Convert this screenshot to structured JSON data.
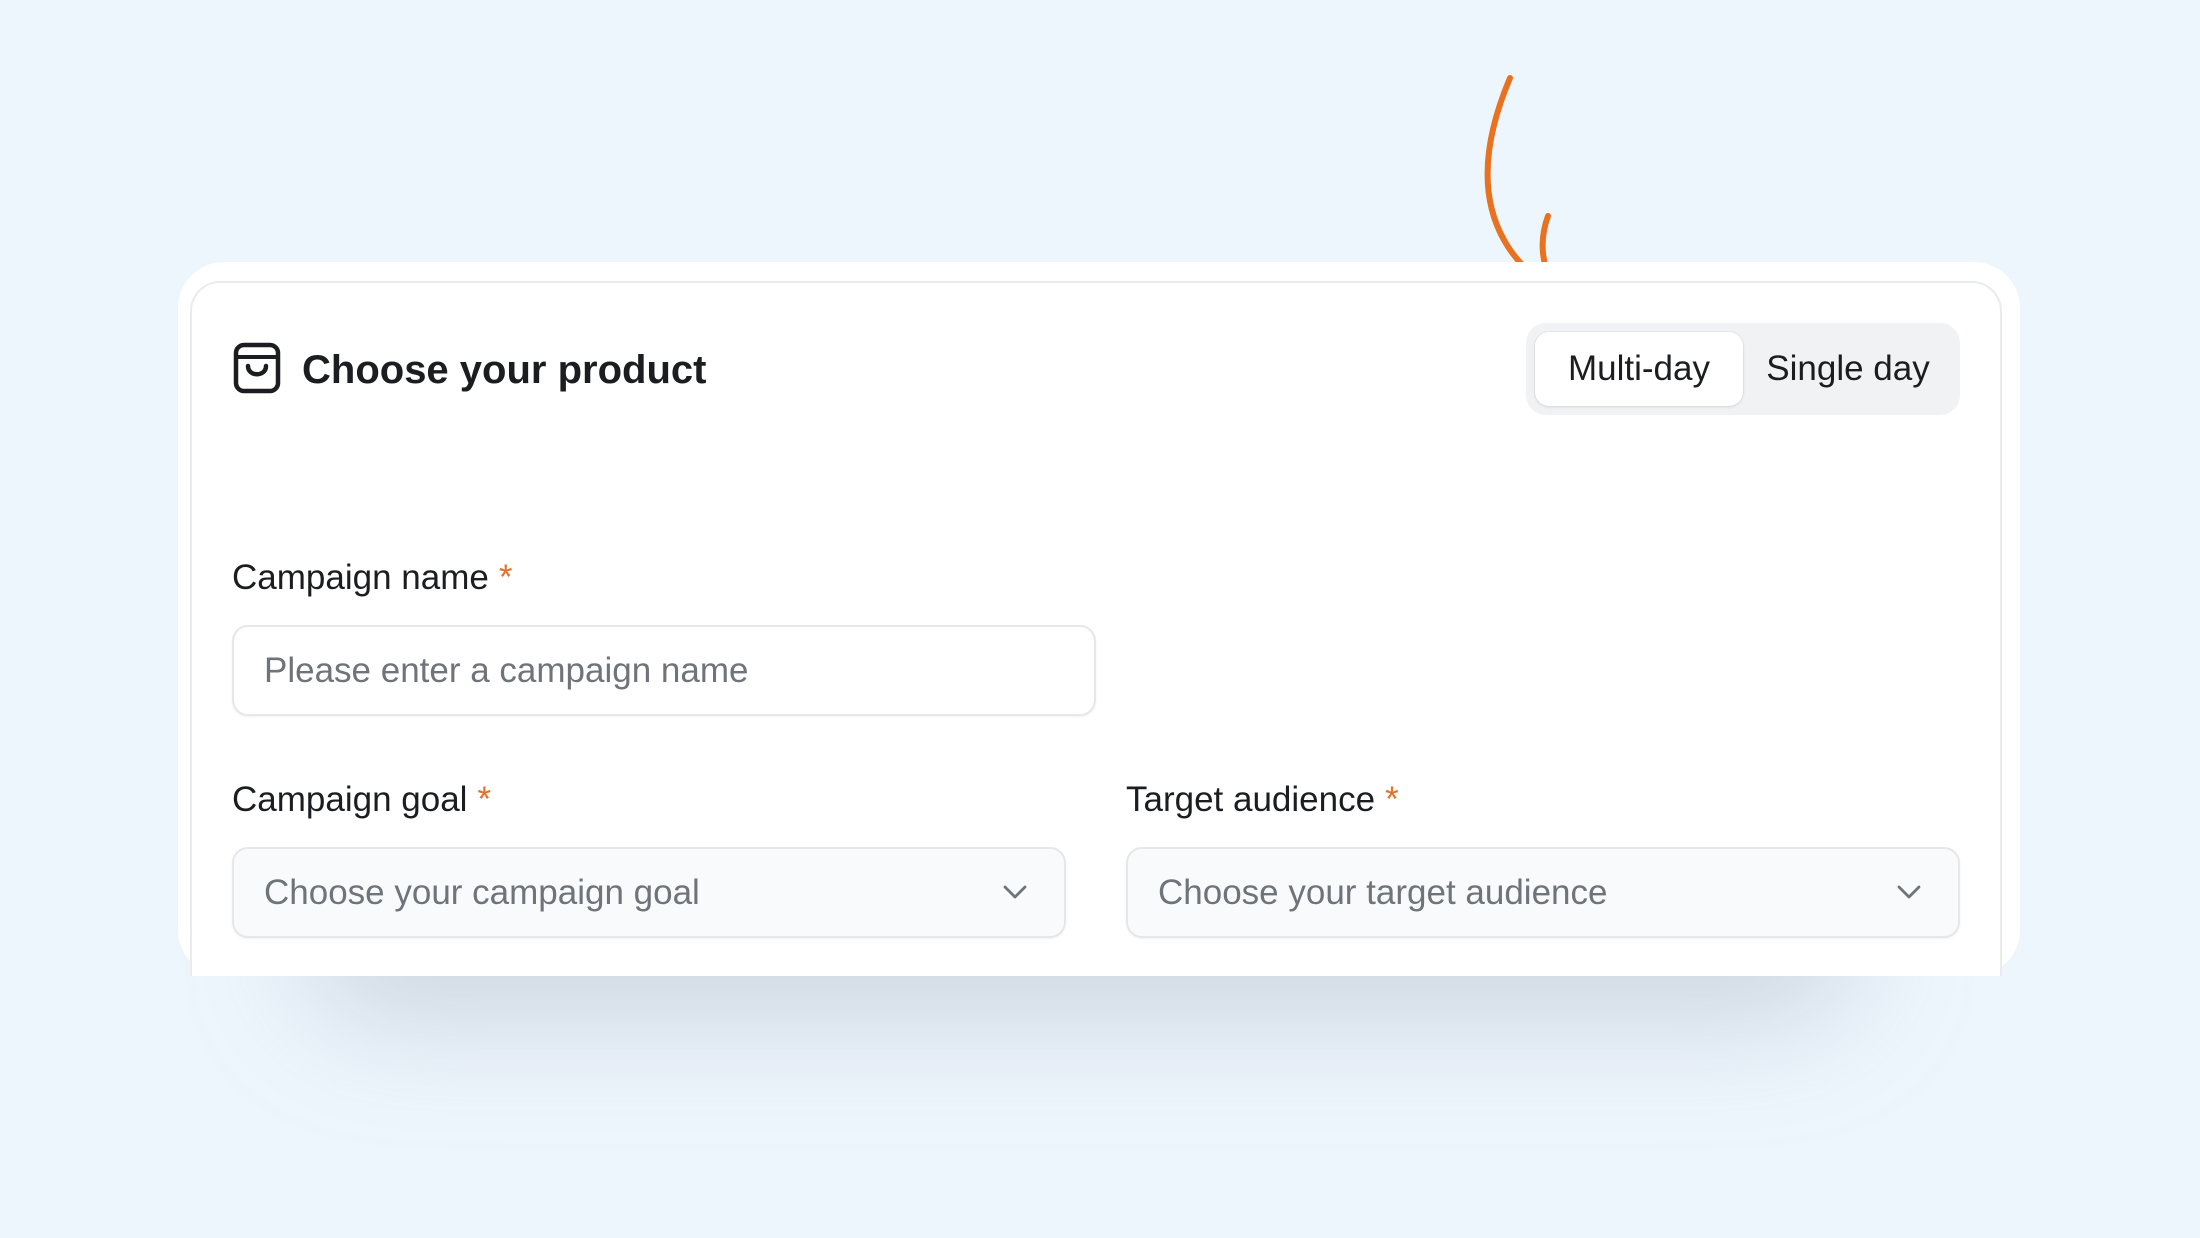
{
  "header": {
    "title": "Choose your product",
    "icon": "shopping-bag-icon"
  },
  "duration_toggle": {
    "options": [
      {
        "label": "Multi-day",
        "selected": true
      },
      {
        "label": "Single day",
        "selected": false
      }
    ]
  },
  "form": {
    "campaign_name": {
      "label": "Campaign name",
      "required_marker": "*",
      "placeholder": "Please enter a campaign name",
      "value": ""
    },
    "campaign_goal": {
      "label": "Campaign goal",
      "required_marker": "*",
      "placeholder": "Choose your campaign goal",
      "icon": "chevron-down-icon"
    },
    "target_audience": {
      "label": "Target audience",
      "required_marker": "*",
      "placeholder": "Choose your target audience",
      "icon": "chevron-down-icon"
    }
  },
  "annotation": {
    "icon": "hand-drawn-arrow-icon",
    "color": "#e8721f"
  },
  "colors": {
    "background": "#eef6fd",
    "required_asterisk": "#e3712a",
    "text": "#1c1d21",
    "placeholder": "#6f737a"
  }
}
